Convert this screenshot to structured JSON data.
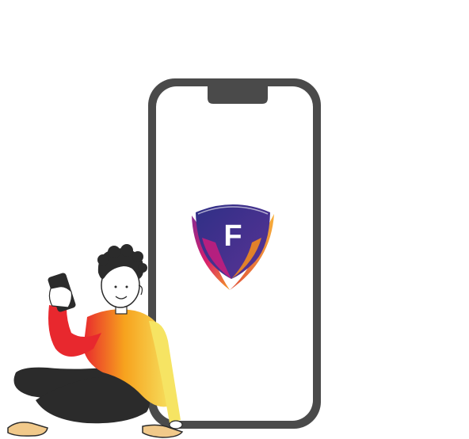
{
  "logo": {
    "letter": "F",
    "colors": {
      "shield_top": "#3b3691",
      "shield_mid": "#7b2f8f",
      "accent_magenta": "#c21e7d",
      "accent_orange": "#f28a1f"
    }
  },
  "phone": {
    "frame_color": "#4a4a4a",
    "screen_color": "#ffffff"
  },
  "person": {
    "sweater_gradient": [
      "#e8282e",
      "#f7a21d",
      "#f6e463"
    ],
    "pants_color": "#2b2b2b",
    "hair_color": "#2b2b2b",
    "shoe_color": "#f1c98a"
  }
}
